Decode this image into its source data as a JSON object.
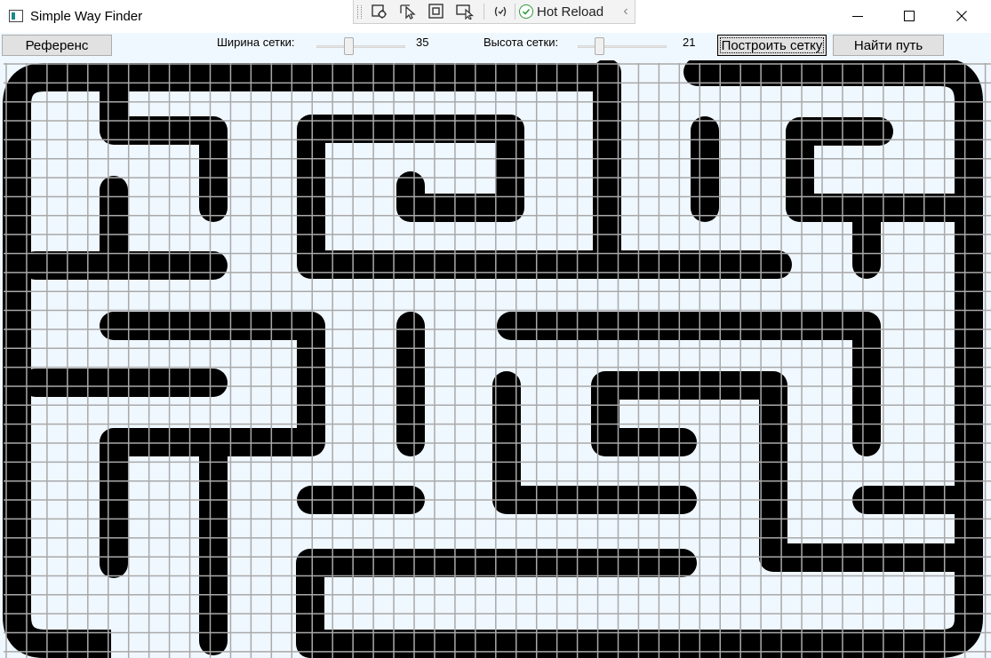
{
  "window": {
    "title": "Simple Way Finder",
    "app_icon": "window-app-icon",
    "minimize_icon": "minimize-icon",
    "maximize_icon": "maximize-icon",
    "close_icon": "close-icon"
  },
  "debug_toolbar": {
    "items": [
      "select-element-icon",
      "select-pointer-icon",
      "display-layout-adorners-icon",
      "track-focused-element-icon",
      "binding-failures-icon"
    ],
    "hot_reload_label": "Hot Reload",
    "hot_reload_status": "ok"
  },
  "controls": {
    "reference_button": "Референс",
    "grid_width_label": "Ширина сетки:",
    "grid_width_value": "35",
    "grid_width_fraction": 0.35,
    "grid_height_label": "Высота сетки:",
    "grid_height_value": "21",
    "grid_height_fraction": 0.21,
    "build_grid_button": "Построить сетку",
    "find_path_button": "Найти путь"
  },
  "grid": {
    "columns": 35,
    "rows": 21,
    "background_color": "#f0f8ff",
    "line_color": "#a9a9a9",
    "wall_color": "#000000"
  },
  "colors": {
    "panel_background": "#f0f8ff",
    "button_background": "#e1e1e1",
    "hot_reload_check": "#2e9b3b"
  }
}
